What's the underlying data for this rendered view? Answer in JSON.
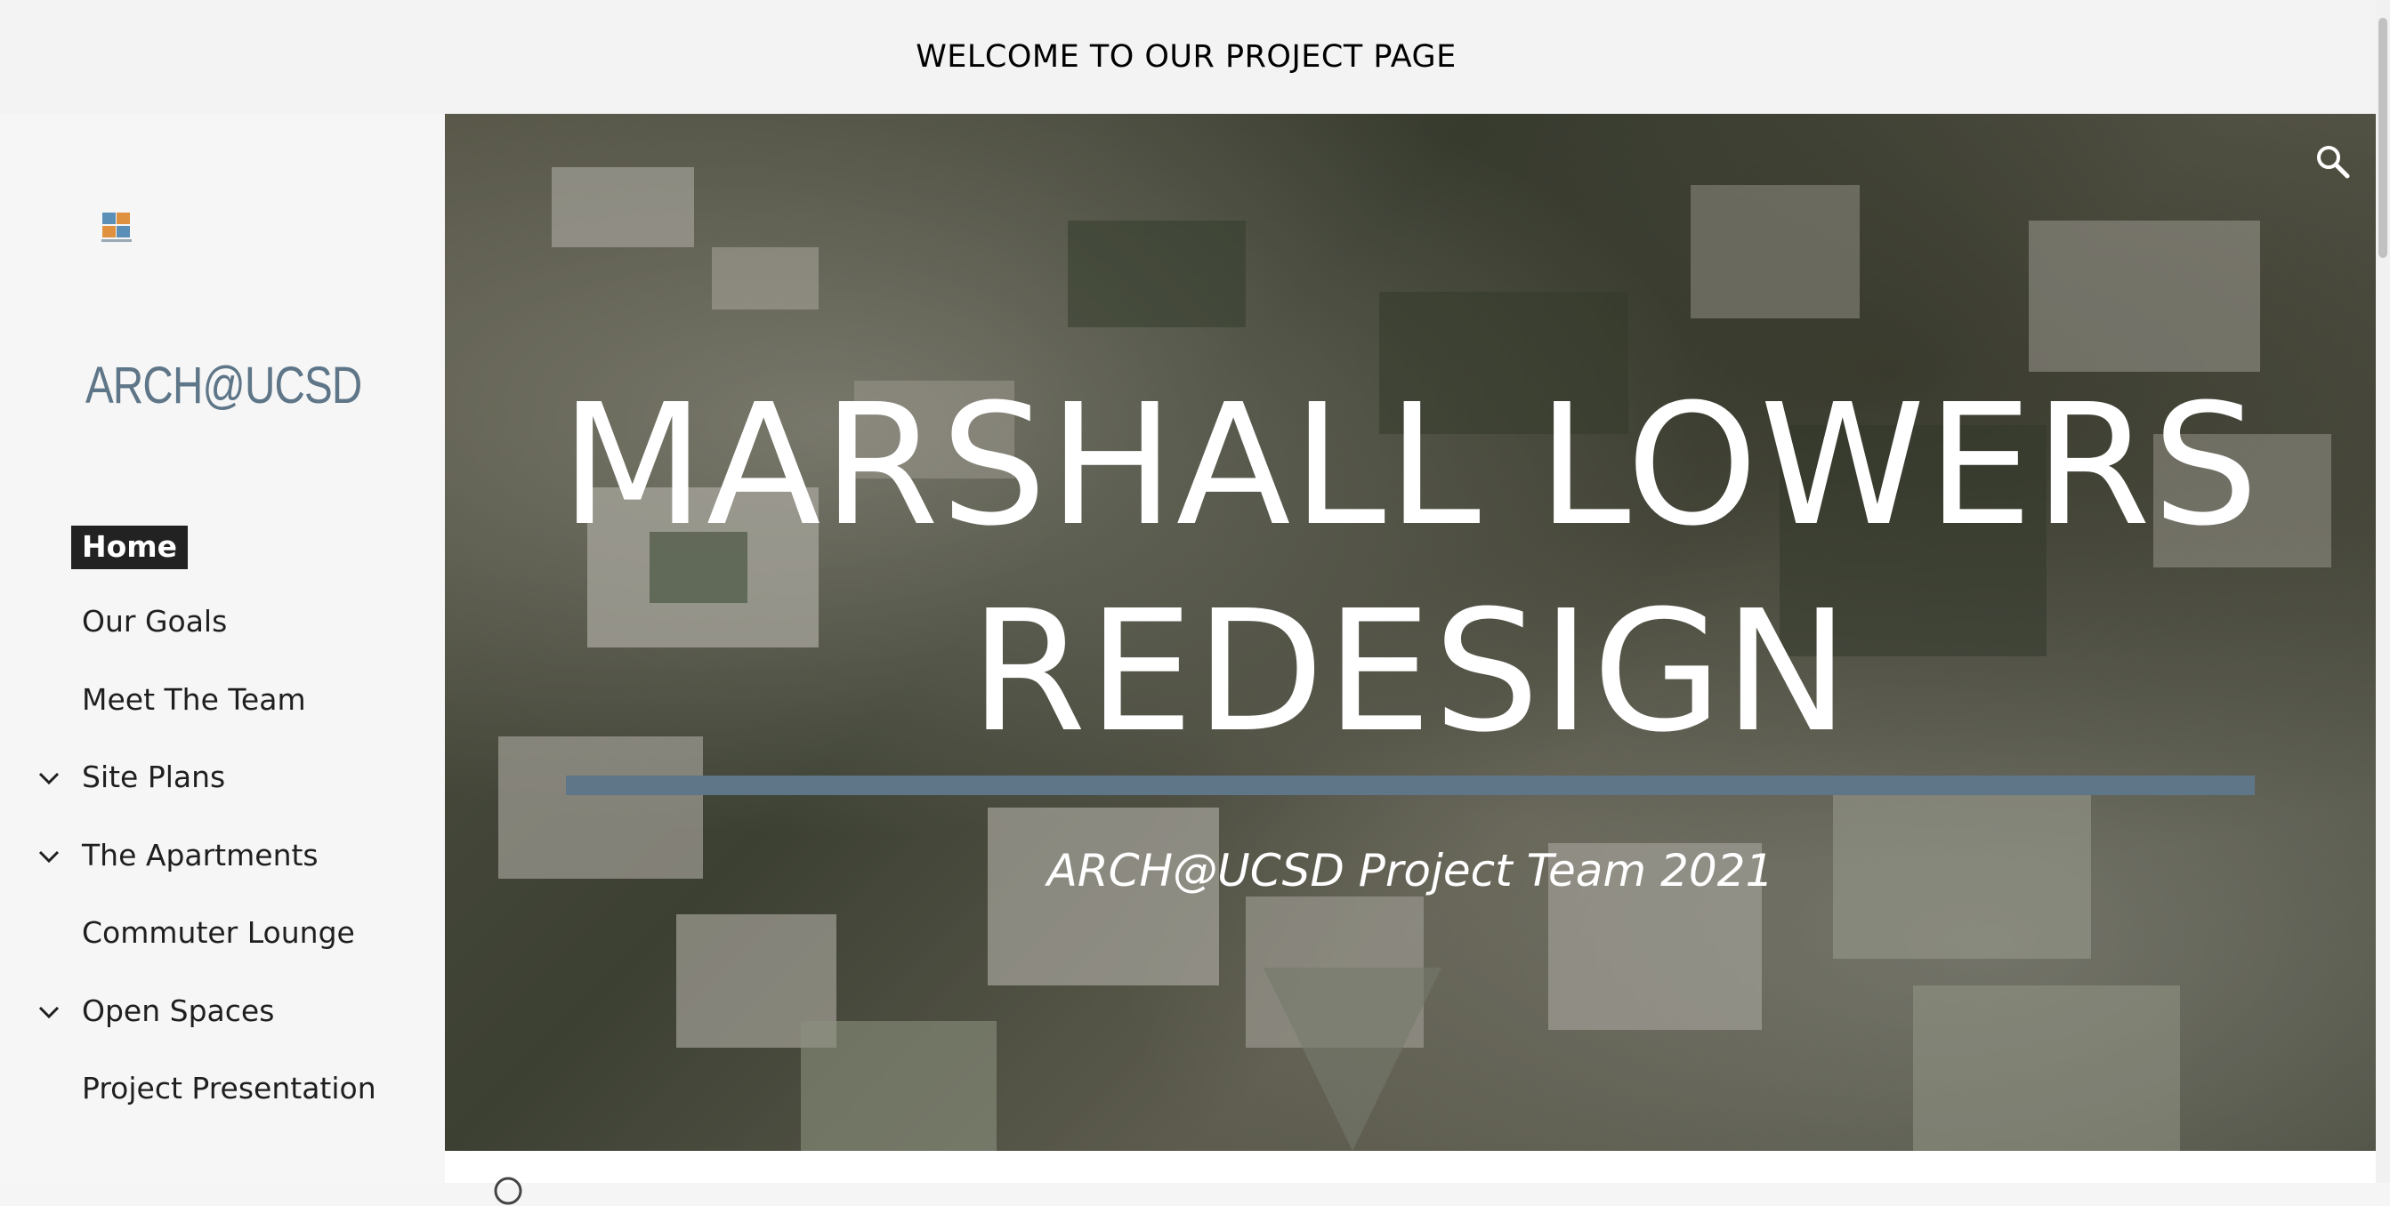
{
  "header": {
    "title": "WELCOME TO OUR PROJECT PAGE"
  },
  "sidebar": {
    "site_name": "ARCH@UCSD",
    "logo_icon": "project-logo-icon",
    "items": [
      {
        "label": "Home",
        "active": true,
        "expandable": false
      },
      {
        "label": "Our Goals",
        "active": false,
        "expandable": false
      },
      {
        "label": "Meet The Team",
        "active": false,
        "expandable": false
      },
      {
        "label": "Site Plans",
        "active": false,
        "expandable": true
      },
      {
        "label": "The Apartments",
        "active": false,
        "expandable": true
      },
      {
        "label": "Commuter Lounge",
        "active": false,
        "expandable": false
      },
      {
        "label": "Open Spaces",
        "active": false,
        "expandable": true
      },
      {
        "label": "Project Presentation",
        "active": false,
        "expandable": false
      }
    ]
  },
  "hero": {
    "title_line1": "MARSHALL LOWERS",
    "title_line2": "REDESIGN",
    "subtitle": "ARCH@UCSD Project Team 2021",
    "search_icon": "search-icon",
    "rule_color": "#5e7688"
  },
  "colors": {
    "accent": "#5e7688",
    "active_nav_bg": "#222222",
    "header_bg": "#f3f3f3"
  }
}
